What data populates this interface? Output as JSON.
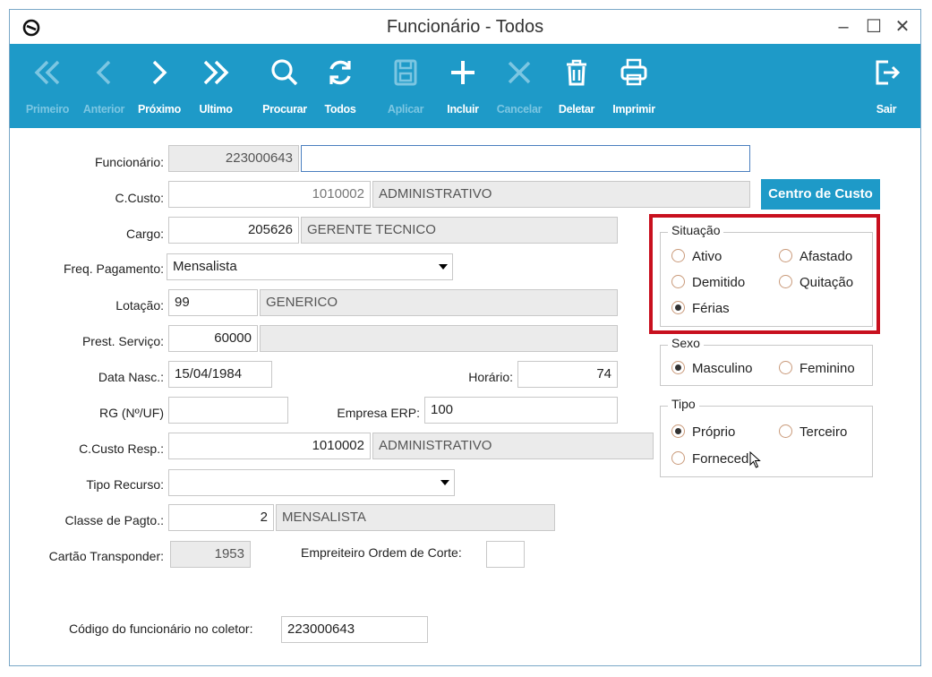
{
  "window": {
    "title": "Funcionário - Todos"
  },
  "toolbar": {
    "primeiro": "Primeiro",
    "anterior": "Anterior",
    "proximo": "Próximo",
    "ultimo": "Ultimo",
    "procurar": "Procurar",
    "todos": "Todos",
    "aplicar": "Aplicar",
    "incluir": "Incluir",
    "cancelar": "Cancelar",
    "deletar": "Deletar",
    "imprimir": "Imprimir",
    "sair": "Sair"
  },
  "form": {
    "funcionario": {
      "label": "Funcionário:",
      "code": "223000643",
      "name": ""
    },
    "ccusto": {
      "label": "C.Custo:",
      "code": "1010002",
      "name": "ADMINISTRATIVO"
    },
    "centro_btn": "Centro de Custo",
    "cargo": {
      "label": "Cargo:",
      "code": "205626",
      "name": "GERENTE TECNICO"
    },
    "freq": {
      "label": "Freq. Pagamento:",
      "value": "Mensalista"
    },
    "lotacao": {
      "label": "Lotação:",
      "code": "99",
      "name": "GENERICO"
    },
    "prest": {
      "label": "Prest. Serviço:",
      "code": "60000",
      "name": ""
    },
    "nasc": {
      "label": "Data Nasc.:",
      "value": "15/04/1984"
    },
    "horario": {
      "label": "Horário:",
      "value": "74"
    },
    "rg": {
      "label": "RG (Nº/UF)",
      "value": ""
    },
    "empresa": {
      "label": "Empresa ERP:",
      "value": "100"
    },
    "ccresp": {
      "label": "C.Custo Resp.:",
      "code": "1010002",
      "name": "ADMINISTRATIVO"
    },
    "tiporec": {
      "label": "Tipo Recurso:",
      "value": ""
    },
    "classe": {
      "label": "Classe de Pagto.:",
      "code": "2",
      "name": "MENSALISTA"
    },
    "cartao": {
      "label": "Cartão Transponder:",
      "value": "1953"
    },
    "empreiteiro": {
      "label": "Empreiteiro Ordem de Corte:",
      "value": ""
    },
    "coletor": {
      "label": "Código do funcionário no coletor:",
      "value": "223000643"
    }
  },
  "situacao": {
    "title": "Situação",
    "ativo": "Ativo",
    "afastado": "Afastado",
    "demitido": "Demitido",
    "quitacao": "Quitação",
    "ferias": "Férias",
    "selected": "Férias"
  },
  "sexo": {
    "title": "Sexo",
    "masculino": "Masculino",
    "feminino": "Feminino",
    "selected": "Masculino"
  },
  "tipo": {
    "title": "Tipo",
    "proprio": "Próprio",
    "terceiro": "Terceiro",
    "fornecedor": "Forneced",
    "selected": "Próprio"
  },
  "colors": {
    "toolbar": "#1e9ac8",
    "highlight": "#c8101e"
  }
}
